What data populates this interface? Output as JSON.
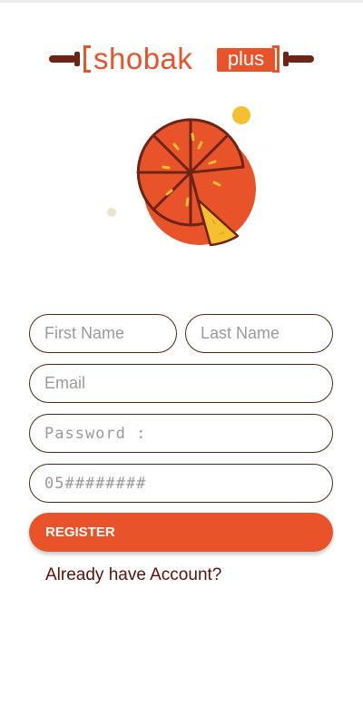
{
  "brand": {
    "name": "shobak",
    "badge": "plus",
    "color_primary": "#e8532a",
    "color_dark": "#6e2415",
    "color_accent": "#f5c02e"
  },
  "illustration": {
    "icon": "pizza-icon"
  },
  "form": {
    "first_name_placeholder": "First Name",
    "last_name_placeholder": "Last Name",
    "email_placeholder": "Email",
    "password_placeholder": "Password :",
    "phone_placeholder": "05########",
    "register_label": "REGISTER",
    "login_link": "Already have Account?"
  }
}
